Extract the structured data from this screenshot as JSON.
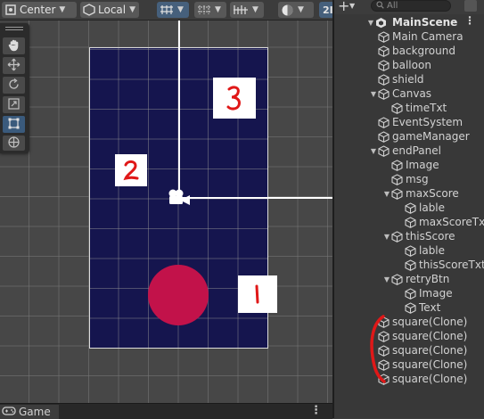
{
  "toolbar": {
    "pivot_label": "Center",
    "space_label": "Local",
    "mode_partial": "2I"
  },
  "scene": {
    "squares": [
      {
        "number": "3"
      },
      {
        "number": "2"
      },
      {
        "number": "1"
      }
    ],
    "colors": {
      "canvas": "#15154e",
      "balloon": "#c2124a",
      "annotation": "#e01818"
    }
  },
  "game_tab": {
    "label": "Game"
  },
  "hierarchy": {
    "search_placeholder": "All",
    "scene_name": "MainScene",
    "items": [
      {
        "label": "Main Camera",
        "depth": 1
      },
      {
        "label": "background",
        "depth": 1
      },
      {
        "label": "balloon",
        "depth": 1
      },
      {
        "label": "shield",
        "depth": 1
      },
      {
        "label": "Canvas",
        "depth": 1,
        "expanded": true
      },
      {
        "label": "timeTxt",
        "depth": 2
      },
      {
        "label": "EventSystem",
        "depth": 1
      },
      {
        "label": "gameManager",
        "depth": 1
      },
      {
        "label": "endPanel",
        "depth": 1,
        "expanded": true
      },
      {
        "label": "Image",
        "depth": 2
      },
      {
        "label": "msg",
        "depth": 2
      },
      {
        "label": "maxScore",
        "depth": 2,
        "expanded": true
      },
      {
        "label": "lable",
        "depth": 3
      },
      {
        "label": "maxScoreTxt",
        "depth": 3
      },
      {
        "label": "thisScore",
        "depth": 2,
        "expanded": true
      },
      {
        "label": "lable",
        "depth": 3
      },
      {
        "label": "thisScoreTxt",
        "depth": 3
      },
      {
        "label": "retryBtn",
        "depth": 2,
        "expanded": true
      },
      {
        "label": "Image",
        "depth": 3
      },
      {
        "label": "Text",
        "depth": 3
      },
      {
        "label": "square(Clone)",
        "depth": 1
      },
      {
        "label": "square(Clone)",
        "depth": 1
      },
      {
        "label": "square(Clone)",
        "depth": 1
      },
      {
        "label": "square(Clone)",
        "depth": 1
      },
      {
        "label": "square(Clone)",
        "depth": 1
      }
    ]
  }
}
